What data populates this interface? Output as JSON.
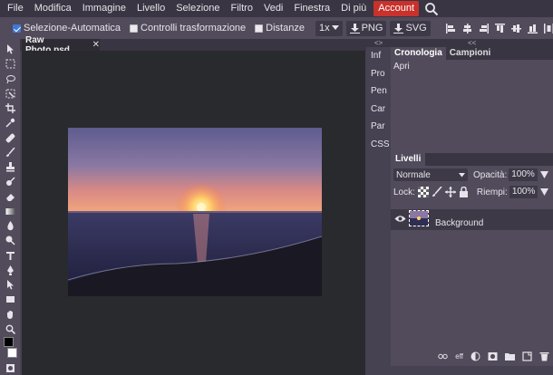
{
  "menubar": {
    "items": [
      "File",
      "Modifica",
      "Immagine",
      "Livello",
      "Selezione",
      "Filtro",
      "Vedi",
      "Finestra",
      "Di più"
    ],
    "account_label": "Account",
    "search_icon": "search-icon"
  },
  "options": {
    "auto_select_label": "Selezione-Automatica",
    "auto_select_checked": true,
    "transform_label": "Controlli trasformazione",
    "transform_checked": false,
    "distances_label": "Distanze",
    "distances_checked": false,
    "scale_value": "1x",
    "png_label": "PNG",
    "svg_label": "SVG"
  },
  "document": {
    "tab_label": "Raw Photo.psd",
    "close_glyph": "✕"
  },
  "side_strip": {
    "collapse": "<>",
    "items": [
      "Inf",
      "Pro",
      "Pen",
      "Car",
      "Par",
      "CSS"
    ]
  },
  "history_panel": {
    "collapse": "<<",
    "tab_history": "Cronologia",
    "tab_swatches": "Campioni",
    "entries": [
      "Apri"
    ]
  },
  "layers_panel": {
    "tab_label": "Livelli",
    "blend_mode": "Normale",
    "opacity_label": "Opacità:",
    "opacity_value": "100%",
    "lock_label": "Lock:",
    "fill_label": "Riempi:",
    "fill_value": "100%",
    "layer_name": "Background",
    "footer_label": "eff"
  },
  "colors": {
    "accent": "#c8312c",
    "panel": "#514b5b",
    "dark": "#3a3542",
    "canvas": "#282a2d"
  }
}
